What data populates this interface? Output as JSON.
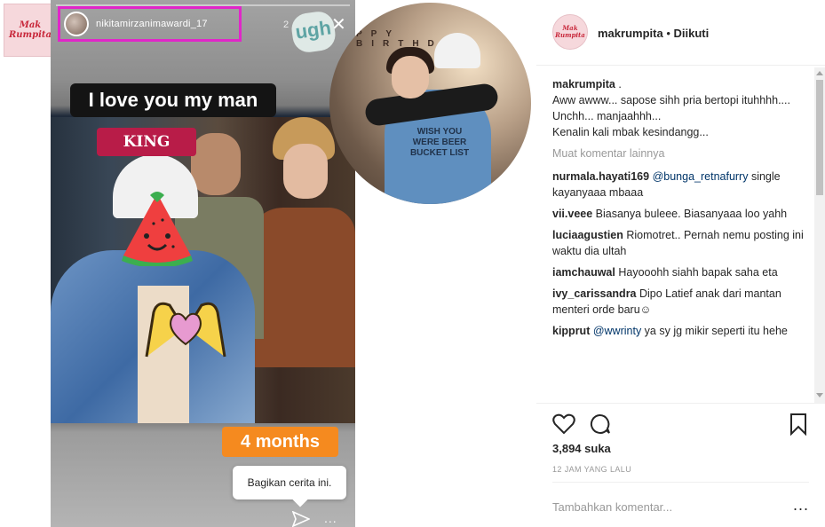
{
  "left_logo": {
    "line1": "Mak",
    "line2": "Rumpita"
  },
  "story": {
    "username": "nikitamirzanimawardi_17",
    "time": "2",
    "ugh_sticker": "ugh",
    "close_icon": "close-icon",
    "caption_top": "I love you my man",
    "king_label": "KING",
    "months_badge": "4 months",
    "share_tooltip": "Bagikan cerita ini.",
    "more_label": "..."
  },
  "circle_photo": {
    "banner": "PPY BIRTHDA",
    "shirt_text": "WISH YOU WERE BEER BUCKET LIST"
  },
  "post": {
    "header": {
      "avatar_line1": "Mak",
      "avatar_line2": "Rumpita",
      "username": "makrumpita",
      "dot": " • ",
      "follow_status": "Diikuti"
    },
    "caption": {
      "username": "makrumpita",
      "first_line": " .",
      "lines": [
        "Aww awww... sapose sihh pria bertopi ituhhhh....",
        "Unchh... manjaahhh...",
        "Kenalin kali mbak kesindangg..."
      ]
    },
    "load_more": "Muat komentar lainnya",
    "comments": [
      {
        "user": "nurmala.hayati169",
        "mention": "@bunga_retnafurry",
        "text": " single kayanyaaa mbaaa"
      },
      {
        "user": "vii.veee",
        "mention": "",
        "text": " Biasanya buleee. Biasanyaaa loo yahh"
      },
      {
        "user": "luciaagustien",
        "mention": "",
        "text": " Riomotret.. Pernah nemu posting ini waktu dia ultah"
      },
      {
        "user": "iamchauwal",
        "mention": "",
        "text": " Hayooohh siahh bapak saha eta"
      },
      {
        "user": "ivy_carissandra",
        "mention": "",
        "text": " Dipo Latief anak dari mantan menteri orde baru☺"
      },
      {
        "user": "kipprut",
        "mention": "@wwrinty",
        "text": " ya sy jg mikir seperti itu hehe"
      }
    ],
    "likes": "3,894 suka",
    "time_ago": "12 JAM YANG LALU",
    "add_comment_placeholder": "Tambahkan komentar...",
    "more_options": "..."
  },
  "colors": {
    "highlight_border": "#e126c9",
    "months_badge": "#f58a1f",
    "king_banner": "#b81c48",
    "mention": "#003569"
  }
}
